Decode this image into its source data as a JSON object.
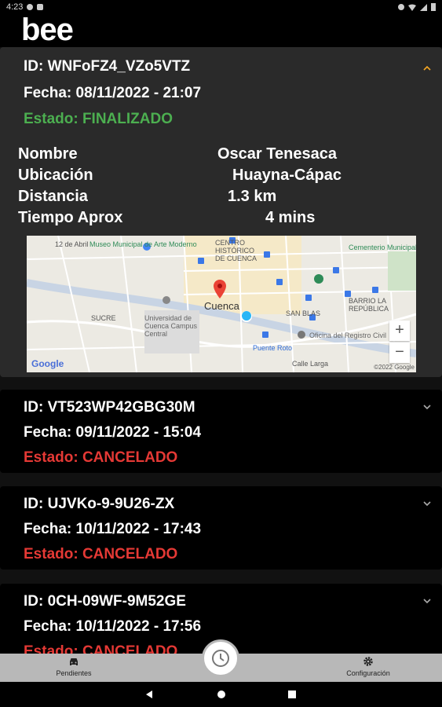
{
  "status_bar": {
    "time": "4:23"
  },
  "app": {
    "logo": "bee"
  },
  "orders": [
    {
      "id": "ID: WNFoFZ4_VZo5VTZ",
      "fecha": "Fecha: 08/11/2022 - 21:07",
      "estado": "Estado: FINALIZADO",
      "estado_color": "#4caf50",
      "expanded": true,
      "details": {
        "nombre_label": "Nombre",
        "nombre_value": "Oscar Tenesaca",
        "ubicacion_label": "Ubicación",
        "ubicacion_value": "Huayna-Cápac",
        "distancia_label": "Distancia",
        "distancia_value": "1.3 km",
        "tiempo_label": "Tiempo Aprox",
        "tiempo_value": "4 mins"
      },
      "map": {
        "labels": {
          "museo": "Museo Municipal de Arte Moderno",
          "centro": "CENTRO HISTÓRICO DE CUENCA",
          "cuenca": "Cuenca",
          "universidad": "Universidad de Cuenca Campus Central",
          "barrio": "BARRIO LA REPÚBLICA",
          "registro": "Oficina del Registro Civil",
          "puente": "Puente Roto",
          "cementerio": "Cementerio Municipal",
          "sucre": "SUCRE",
          "san_blas": "SAN BLAS",
          "calle_larga": "Calle Larga",
          "abril": "12 de Abril"
        },
        "zoom_in": "+",
        "zoom_out": "−",
        "google": "Google",
        "copyright": "©2022 Google"
      }
    },
    {
      "id": "ID: VT523WP42GBG30M",
      "fecha": "Fecha: 09/11/2022 - 15:04",
      "estado": "Estado: CANCELADO",
      "estado_color": "#e53935",
      "expanded": false
    },
    {
      "id": "ID: UJVKo-9-9U26-ZX",
      "fecha": "Fecha: 10/11/2022 - 17:43",
      "estado": "Estado: CANCELADO",
      "estado_color": "#e53935",
      "expanded": false
    },
    {
      "id": "ID: 0CH-09WF-9M52GE",
      "fecha": "Fecha: 10/11/2022 - 17:56",
      "estado": "Estado: CANCELADO",
      "estado_color": "#e53935",
      "expanded": false
    }
  ],
  "bottom_nav": {
    "pendientes": "Pendientes",
    "configuracion": "Configuración",
    "pendientes_icon": "car-icon",
    "configuracion_icon": "gear-icon",
    "history_icon": "clock-icon"
  }
}
